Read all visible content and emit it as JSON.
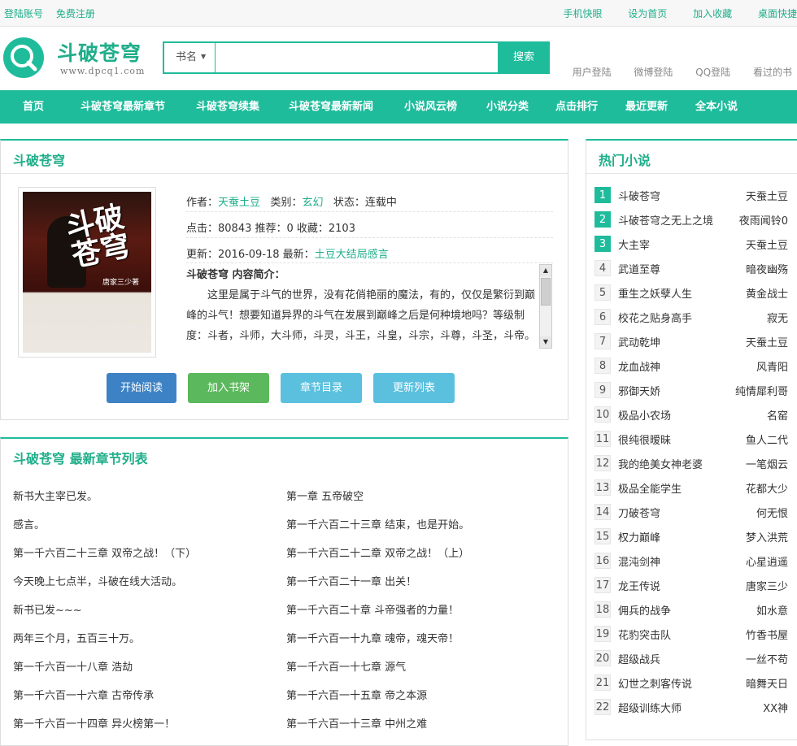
{
  "topbar": {
    "login": "登陆账号",
    "register": "免费注册",
    "right_links": [
      "手机快眼",
      "设为首页",
      "加入收藏",
      "桌面快捷"
    ]
  },
  "site": {
    "title": "斗破苍穹",
    "url": "www.dpcq1.com"
  },
  "search": {
    "category": "书名",
    "value": "",
    "button": "搜索"
  },
  "login_links": [
    "用户登陆",
    "微博登陆",
    "QQ登陆",
    "看过的书"
  ],
  "nav": [
    "首页",
    "斗破苍穹最新章节",
    "斗破苍穹续集",
    "斗破苍穹最新新闻",
    "小说风云榜",
    "小说分类",
    "点击排行",
    "最近更新",
    "全本小说"
  ],
  "book": {
    "panel_title": "斗破苍穹",
    "cover_title": "斗破苍穹",
    "cover_author": "唐家三少著",
    "author_label": "作者：",
    "author": "天蚕土豆",
    "category_label": "类别：",
    "category": "玄幻",
    "status": "状态：连载中",
    "stats": "点击：80843  推荐：0  收藏：2103",
    "updated_label": "更新：2016-09-18  最新：",
    "latest": "土豆大结局感言",
    "intro_heading": "斗破苍穹 内容简介：",
    "intro_text": "这里是属于斗气的世界，没有花俏艳丽的魔法，有的，仅仅是繁衍到巅峰的斗气！想要知道异界的斗气在发展到巅峰之后是何种境地吗？等级制度：斗者，斗师，大斗师，斗灵，斗王，斗皇，斗宗，斗尊，斗圣，斗帝。",
    "buttons": [
      "开始阅读",
      "加入书架",
      "章节目录",
      "更新列表"
    ],
    "button_colors": [
      "#3d82c4",
      "#5cb85c",
      "#5bc0de",
      "#5bc0de"
    ]
  },
  "chapters": {
    "panel_title": "斗破苍穹 最新章节列表",
    "left": [
      "新书大主宰已发。",
      "感言。",
      "第一千六百二十三章 双帝之战！（下）",
      "今天晚上七点半，斗破在线大活动。",
      "新书已发~~~",
      "两年三个月，五百三十万。",
      "第一千六百一十八章 浩劫",
      "第一千六百一十六章 古帝传承",
      "第一千六百一十四章 异火榜第一！"
    ],
    "right": [
      "第一章 五帝破空",
      "第一千六百二十三章 结束，也是开始。",
      "第一千六百二十二章 双帝之战！（上）",
      "第一千六百二十一章 出关！",
      "第一千六百二十章 斗帝强者的力量！",
      "第一千六百一十九章 魂帝，魂天帝！",
      "第一千六百一十七章 源气",
      "第一千六百一十五章 帝之本源",
      "第一千六百一十三章 中州之难"
    ]
  },
  "hot": {
    "title": "热门小说",
    "items": [
      {
        "rank": "1",
        "name": "斗破苍穹",
        "author": "天蚕土豆"
      },
      {
        "rank": "2",
        "name": "斗破苍穹之无上之境",
        "author": "夜雨闻铃0"
      },
      {
        "rank": "3",
        "name": "大主宰",
        "author": "天蚕土豆"
      },
      {
        "rank": "4",
        "name": "武道至尊",
        "author": "暗夜幽殇"
      },
      {
        "rank": "5",
        "name": "重生之妖孽人生",
        "author": "黄金战士"
      },
      {
        "rank": "6",
        "name": "校花之贴身高手",
        "author": "寂无"
      },
      {
        "rank": "7",
        "name": "武动乾坤",
        "author": "天蚕土豆"
      },
      {
        "rank": "8",
        "name": "龙血战神",
        "author": "风青阳"
      },
      {
        "rank": "9",
        "name": "邪御天娇",
        "author": "纯情犀利哥"
      },
      {
        "rank": "10",
        "name": "极品小农场",
        "author": "名窑"
      },
      {
        "rank": "11",
        "name": "很纯很暧昧",
        "author": "鱼人二代"
      },
      {
        "rank": "12",
        "name": "我的绝美女神老婆",
        "author": "一笔烟云"
      },
      {
        "rank": "13",
        "name": "极品全能学生",
        "author": "花都大少"
      },
      {
        "rank": "14",
        "name": "刀破苍穹",
        "author": "何无恨"
      },
      {
        "rank": "15",
        "name": "权力巅峰",
        "author": "梦入洪荒"
      },
      {
        "rank": "16",
        "name": "混沌剑神",
        "author": "心星逍遥"
      },
      {
        "rank": "17",
        "name": "龙王传说",
        "author": "唐家三少"
      },
      {
        "rank": "18",
        "name": "佣兵的战争",
        "author": "如水意"
      },
      {
        "rank": "19",
        "name": "花豹突击队",
        "author": "竹香书屋"
      },
      {
        "rank": "20",
        "name": "超级战兵",
        "author": "一丝不苟"
      },
      {
        "rank": "21",
        "name": "幻世之刺客传说",
        "author": "暗舞天日"
      },
      {
        "rank": "22",
        "name": "超级训练大师",
        "author": "XX神"
      }
    ]
  },
  "colors": {
    "accent": "#1fbc9c",
    "link": "#1fae8a"
  }
}
